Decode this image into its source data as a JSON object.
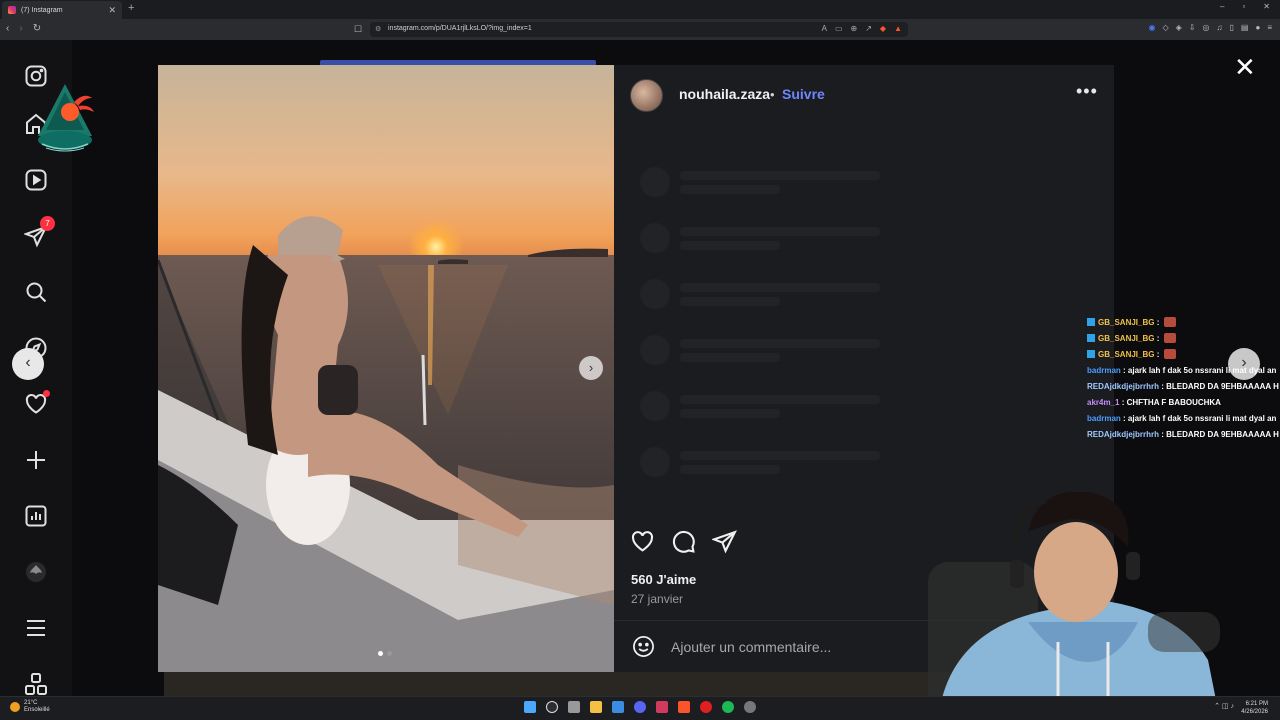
{
  "browser": {
    "tab_title": "(7) Instagram",
    "tab_close": "✕",
    "new_tab": "+",
    "window_controls": [
      "–",
      "▫",
      "✕"
    ],
    "url": "instagram.com/p/DUA1rjlLksLO/?img_index=1"
  },
  "sidebar": {
    "messages_badge": "7"
  },
  "post": {
    "username": "nouhaila.zaza",
    "separator": "•",
    "follow_label": "Suivre",
    "more_label": "•••",
    "likes": "560 J'aime",
    "date": "27 janvier",
    "comment_placeholder": "Ajouter un commentaire...",
    "next_image": "›",
    "image_count": 2,
    "current_image": 1
  },
  "modal": {
    "close": "✕",
    "prev": "‹",
    "next": "›"
  },
  "chat": [
    {
      "user": "GB_SANJI_BG",
      "color": "#f0c24a",
      "badge": true,
      "emote": true,
      "text": ""
    },
    {
      "user": "GB_SANJI_BG",
      "color": "#f0c24a",
      "badge": true,
      "emote": true,
      "text": ""
    },
    {
      "user": "GB_SANJI_BG",
      "color": "#f0c24a",
      "badge": true,
      "emote": true,
      "text": ""
    },
    {
      "user": "badrman",
      "color": "#4a9eff",
      "badge": false,
      "emote": false,
      "text": "ajark lah f dak 5o nssrani li mat dyal an"
    },
    {
      "user": "REDAjdkdjejbrrhrh",
      "color": "#9ec9ff",
      "badge": false,
      "emote": false,
      "text": "BLEDARD DA 9EHBAAAAA H"
    },
    {
      "user": "akr4m_1",
      "color": "#c58cff",
      "badge": false,
      "emote": false,
      "text": "CHFTHA F BABOUCHKA"
    },
    {
      "user": "badrman",
      "color": "#4a9eff",
      "badge": false,
      "emote": false,
      "text": "ajark lah f dak 5o nssrani li mat dyal an"
    },
    {
      "user": "REDAjdkdjejbrrhrh",
      "color": "#9ec9ff",
      "badge": false,
      "emote": false,
      "text": "BLEDARD DA 9EHBAAAAA H"
    }
  ],
  "taskbar": {
    "temperature": "21°C",
    "weather": "Ensoleillé",
    "time": "6:21 PM",
    "date": "4/26/2026"
  },
  "colors": {
    "follow": "#6f86ff",
    "badge": "#ff3040",
    "panel_bg": "#1b1c1f"
  }
}
